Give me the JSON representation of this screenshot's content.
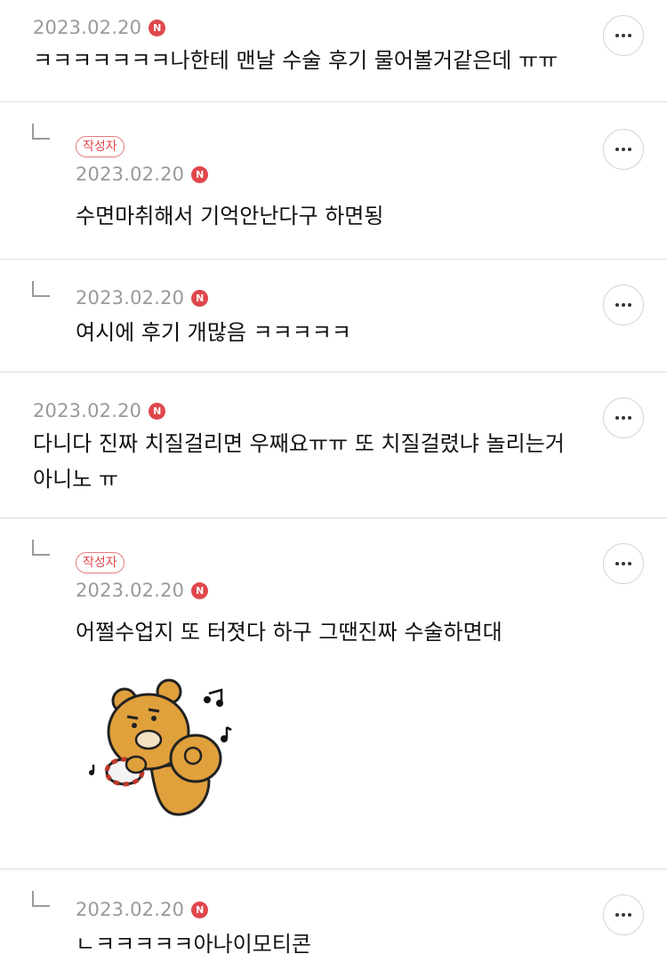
{
  "comments": [
    {
      "date": "2023.02.20",
      "new": "N",
      "text": "ㅋㅋㅋㅋㅋㅋㅋ나한테 맨날 수술 후기 물어볼거같은데 ㅠㅠ",
      "is_reply": false,
      "author": ""
    },
    {
      "date": "2023.02.20",
      "new": "N",
      "text": "수면마취해서 기억안난다구 하면됭",
      "is_reply": true,
      "author": "작성자"
    },
    {
      "date": "2023.02.20",
      "new": "N",
      "text": "여시에 후기 개많음 ㅋㅋㅋㅋㅋ",
      "is_reply": true,
      "author": ""
    },
    {
      "date": "2023.02.20",
      "new": "N",
      "text": "다니다 진짜 치질걸리면 우째요ㅠㅠ 또 치질걸렸냐 놀리는거 아니노 ㅠ",
      "is_reply": false,
      "author": ""
    },
    {
      "date": "2023.02.20",
      "new": "N",
      "text": "어쩔수업지  또 터졋다 하구 그땐진짜 수술하면대",
      "is_reply": true,
      "author": "작성자",
      "sticker": "ryan-tambourine-sticker"
    },
    {
      "date": "2023.02.20",
      "new": "N",
      "text": "ㄴㅋㅋㅋㅋㅋ아나이모티콘",
      "is_reply": true,
      "author": ""
    }
  ],
  "icons": {
    "more": "more-dots-icon",
    "reply": "reply-arrow-icon",
    "new_badge": "new-badge-icon"
  },
  "colors": {
    "new_badge": "#e0474c",
    "author_badge": "#e0474c",
    "date": "#9a9a9a",
    "divider": "#dedede"
  }
}
